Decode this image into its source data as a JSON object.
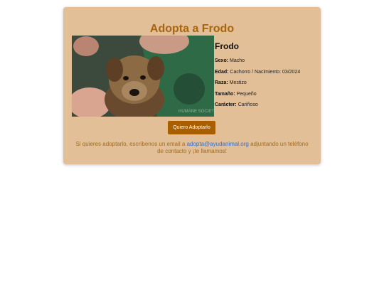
{
  "page": {
    "title": "Adopta a Frodo"
  },
  "pet": {
    "name": "Frodo",
    "details": [
      {
        "label": "Sexo:",
        "value": "Macho"
      },
      {
        "label": "Edad:",
        "value": "Cachorro / Nacimiento: 03/2024"
      },
      {
        "label": "Raza:",
        "value": "Mestizo"
      },
      {
        "label": "Tamaño:",
        "value": "Pequeño"
      },
      {
        "label": "Carácter:",
        "value": "Cariñoso"
      }
    ]
  },
  "actions": {
    "adopt_label": "Quiero Adoptarlo"
  },
  "contact": {
    "before": "Si quieres adoptarlo, escríbenos un email a",
    "email": "adopta@ayudanimal.org",
    "after": "adjuntando un teléfono de contacto y ¡te llamamos!"
  },
  "colors": {
    "card_bg": "#e2bf97",
    "title": "#a6650e",
    "button_bg": "#a85f00",
    "link": "#2f6fd0",
    "contact_text": "#a06a22"
  }
}
